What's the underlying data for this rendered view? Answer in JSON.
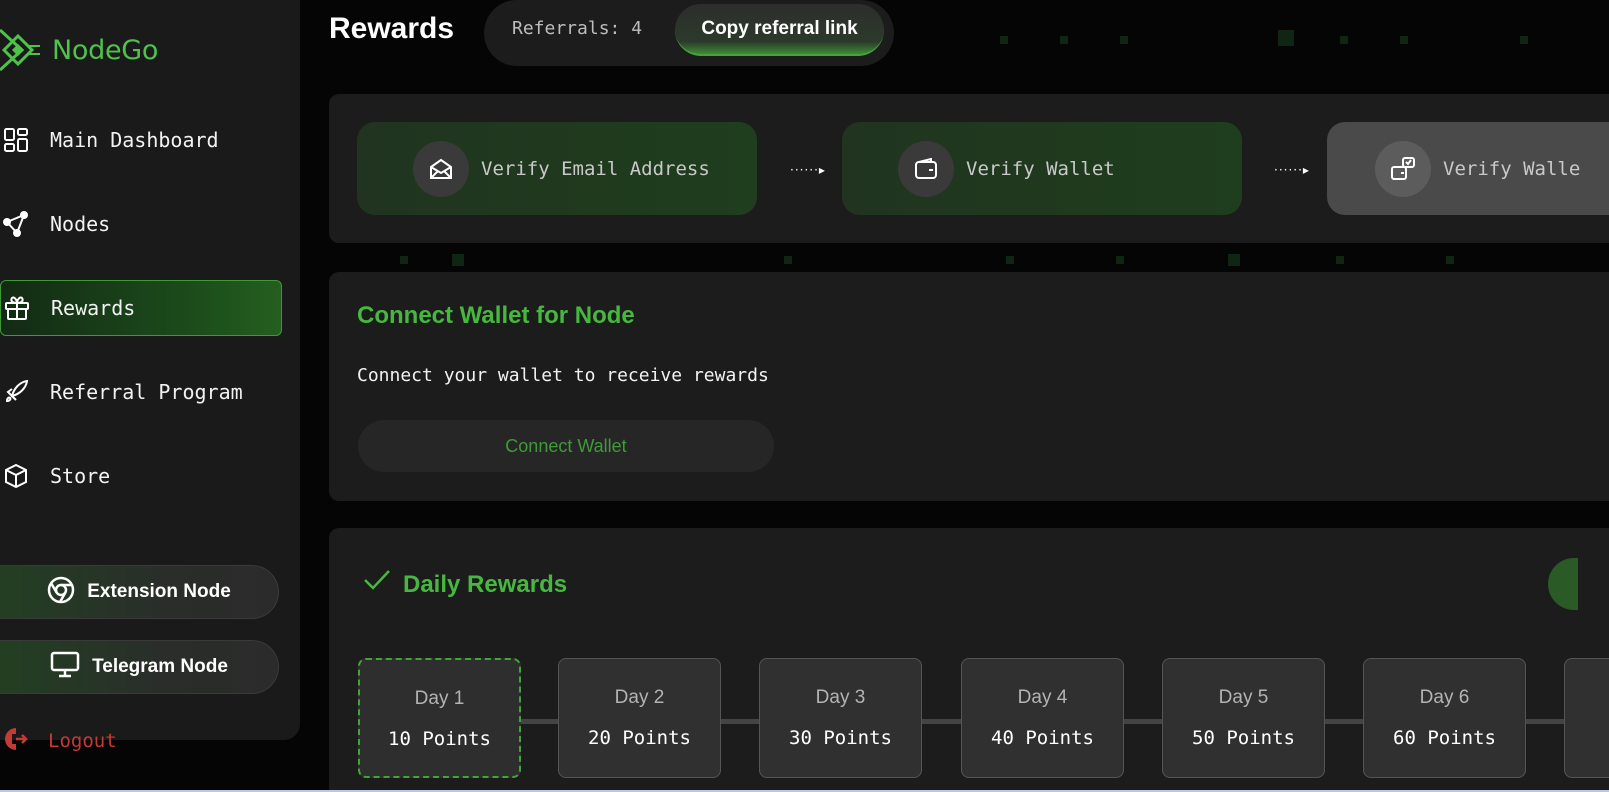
{
  "brand": {
    "name": "NodeGo"
  },
  "sidebar": {
    "items": [
      {
        "label": "Main Dashboard",
        "icon": "grid-icon",
        "active": false
      },
      {
        "label": "Nodes",
        "icon": "nodes-icon",
        "active": false
      },
      {
        "label": "Rewards",
        "icon": "gift-icon",
        "active": true
      },
      {
        "label": "Referral Program",
        "icon": "rocket-icon",
        "active": false
      },
      {
        "label": "Store",
        "icon": "cube-icon",
        "active": false
      }
    ],
    "extension_button": "Extension Node",
    "telegram_button": "Telegram Node",
    "logout": "Logout"
  },
  "header": {
    "title": "Rewards",
    "referrals": "Referrals: 4",
    "copy_link": "Copy referral link"
  },
  "steps": [
    {
      "label": "Verify Email Address",
      "icon": "envelope-icon",
      "status": "done"
    },
    {
      "label": "Verify Wallet",
      "icon": "wallet-icon",
      "status": "done"
    },
    {
      "label": "Verify Walle",
      "icon": "wallet-check-icon",
      "status": "pending"
    }
  ],
  "wallet": {
    "title": "Connect Wallet for Node",
    "subtitle": "Connect your wallet to receive rewards",
    "button": "Connect Wallet"
  },
  "daily": {
    "title": "Daily Rewards",
    "days": [
      {
        "day": "Day 1",
        "points": "10 Points",
        "today": true
      },
      {
        "day": "Day 2",
        "points": "20 Points",
        "today": false
      },
      {
        "day": "Day 3",
        "points": "30 Points",
        "today": false
      },
      {
        "day": "Day 4",
        "points": "40 Points",
        "today": false
      },
      {
        "day": "Day 5",
        "points": "50 Points",
        "today": false
      },
      {
        "day": "Day 6",
        "points": "60 Points",
        "today": false
      }
    ]
  },
  "colors": {
    "accent": "#47b83f",
    "logout": "#c43a34",
    "background": "#050505",
    "panel": "#1c1c1c"
  }
}
